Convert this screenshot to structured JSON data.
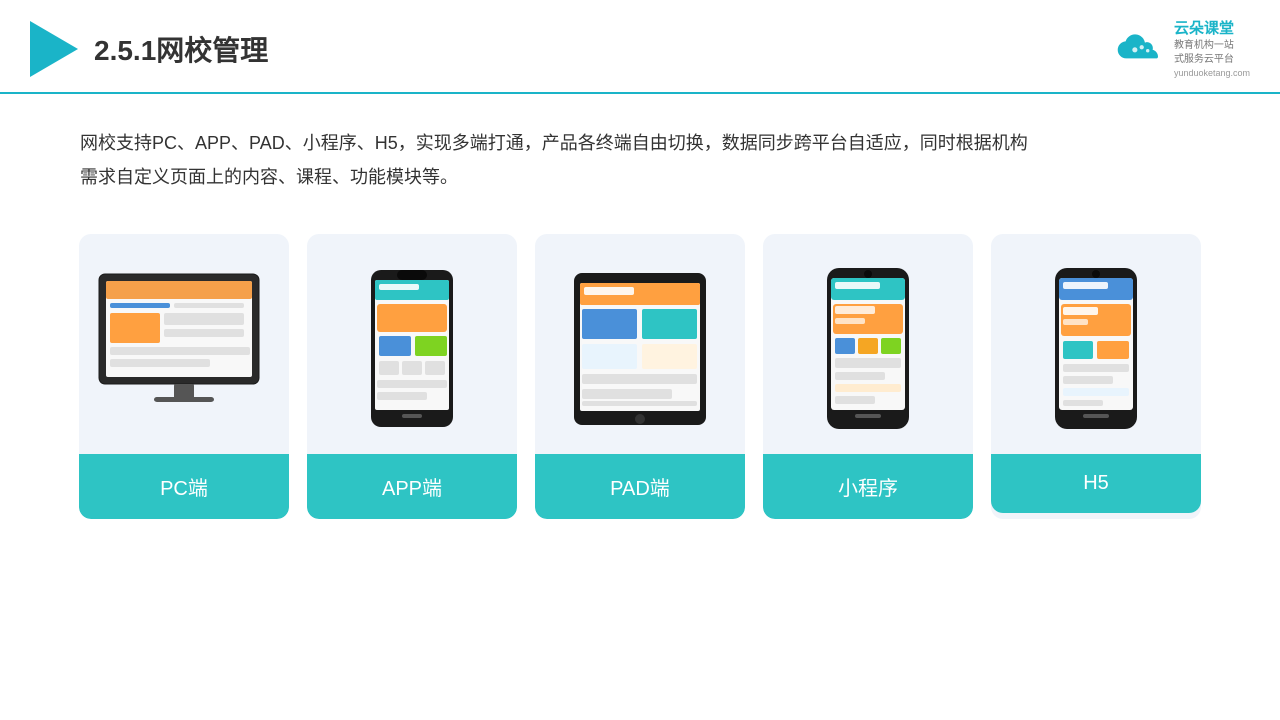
{
  "header": {
    "section_number": "2.5.1",
    "title": "网校管理",
    "brand_name": "云朵课堂",
    "brand_tagline_line1": "教育机构一站",
    "brand_tagline_line2": "式服务云平台",
    "brand_url": "yunduoketang.com"
  },
  "description": {
    "text": "网校支持PC、APP、PAD、小程序、H5，实现多端打通，产品各终端自由切换，数据同步跨平台自适应，同时根据机构",
    "text2": "需求自定义页面上的内容、课程、功能模块等。"
  },
  "cards": [
    {
      "id": "pc",
      "label": "PC端"
    },
    {
      "id": "app",
      "label": "APP端"
    },
    {
      "id": "pad",
      "label": "PAD端"
    },
    {
      "id": "mini",
      "label": "小程序"
    },
    {
      "id": "h5",
      "label": "H5"
    }
  ]
}
